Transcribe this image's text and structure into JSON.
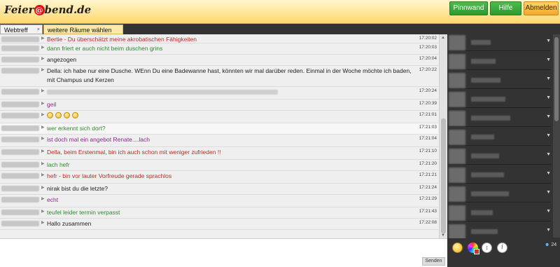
{
  "header": {
    "logo_left": "Feier",
    "logo_at": "@",
    "logo_right": "bend.de",
    "buttons": [
      "Pinnwand",
      "Hilfe",
      "Abmelden"
    ]
  },
  "tabs": {
    "active": "Webtreff",
    "close": "×",
    "more_rooms": "weitere Räume wählen"
  },
  "messages": [
    {
      "time": "17:20:02",
      "text": "Bertie - Du überschätzt meine akrobatischen Fähigkeiten",
      "color": "#b0302a"
    },
    {
      "time": "17:20:03",
      "text": "dann friert er auch nicht beim duschen grins",
      "color": "#2e8b2e"
    },
    {
      "time": "17:20:04",
      "text": "angezogen",
      "color": "#222222"
    },
    {
      "time": "17:20:22",
      "text": "Della: ich habe nur eine Dusche. WEnn Du eine Badewanne hast, könnten wir mal darüber reden. Einmal in der Woche möchte ich baden, mit Champus und Kerzen",
      "color": "#222222"
    },
    {
      "time": "17:20:24",
      "text": "",
      "color": "#999999"
    },
    {
      "time": "17:20:39",
      "text": "geil",
      "color": "#8a2a8a"
    },
    {
      "time": "17:21:01",
      "text": "",
      "color": "#222222"
    },
    {
      "time": "17:21:03",
      "text": "wer erkennt sich dort?",
      "color": "#2e8b2e"
    },
    {
      "time": "17:21:04",
      "text": "ist doch mal ein angebot Renate....lach",
      "color": "#8a2a8a"
    },
    {
      "time": "17:21:10",
      "text": "Della, beim Erstenmal, bin ich auch schon mit weniger zufrieden !!",
      "color": "#b0302a"
    },
    {
      "time": "17:21:20",
      "text": "lach hefr",
      "color": "#2e8b2e"
    },
    {
      "time": "17:21:21",
      "text": "hefr - bin vor lauter Vorfreude gerade sprachlos",
      "color": "#b0302a"
    },
    {
      "time": "17:21:24",
      "text": "nirak bist du die letzte?",
      "color": "#222222"
    },
    {
      "time": "17:21:29",
      "text": "echt",
      "color": "#8a2a8a"
    },
    {
      "time": "17:21:43",
      "text": "teufel leider termin verpasst",
      "color": "#2e8b2e"
    },
    {
      "time": "17:22:08",
      "text": "Hallo zusammen",
      "color": "#222222"
    }
  ],
  "send_label": "Senden",
  "user_count": "24"
}
